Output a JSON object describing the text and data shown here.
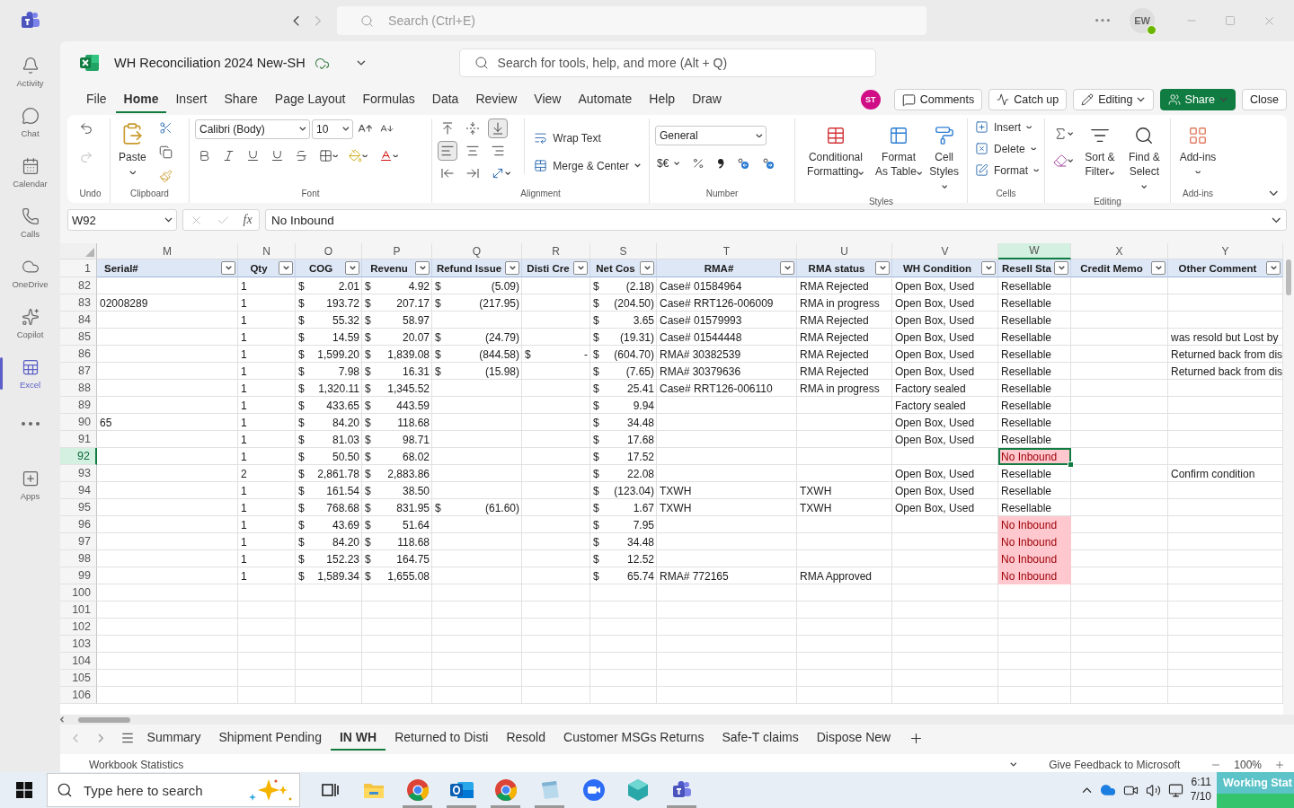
{
  "teams_bar": {
    "search": {
      "placeholder": "Search (Ctrl+E)"
    },
    "avatar": "EW"
  },
  "rail": [
    {
      "label": "Activity",
      "kind": "bell",
      "selected": false
    },
    {
      "label": "Chat",
      "kind": "chat",
      "selected": false
    },
    {
      "label": "Calendar",
      "kind": "calendar",
      "selected": false
    },
    {
      "label": "Calls",
      "kind": "calls",
      "selected": false
    },
    {
      "label": "OneDrive",
      "kind": "cloud",
      "selected": false
    },
    {
      "label": "Copilot",
      "kind": "copilot",
      "selected": false
    },
    {
      "label": "Excel",
      "kind": "excel",
      "selected": true
    },
    {
      "kind": "more",
      "selected": false
    },
    {
      "label": "Apps",
      "kind": "apps",
      "selected": false
    }
  ],
  "workbook": {
    "title": "WH Reconciliation 2024 New-SH",
    "search": {
      "placeholder": "Search for tools, help, and more (Alt + Q)"
    }
  },
  "menu": [
    {
      "label": "File",
      "selected": false
    },
    {
      "label": "Home",
      "selected": true
    },
    {
      "label": "Insert",
      "selected": false
    },
    {
      "label": "Share",
      "selected": false
    },
    {
      "label": "Page Layout",
      "selected": false
    },
    {
      "label": "Formulas",
      "selected": false
    },
    {
      "label": "Data",
      "selected": false
    },
    {
      "label": "Review",
      "selected": false
    },
    {
      "label": "View",
      "selected": false
    },
    {
      "label": "Automate",
      "selected": false
    },
    {
      "label": "Help",
      "selected": false
    },
    {
      "label": "Draw",
      "selected": false
    }
  ],
  "actions": {
    "presence": "ST",
    "buttons": [
      {
        "label": "Comments",
        "kind": "comments"
      },
      {
        "label": "Catch up",
        "kind": "catchup"
      },
      {
        "label": "Editing",
        "kind": "editing"
      },
      {
        "label": "Share",
        "kind": "share"
      },
      {
        "label": "Close",
        "kind": "close"
      }
    ]
  },
  "ribbon": {
    "undo": {
      "label": "Undo"
    },
    "clipboard": {
      "paste": "Paste",
      "label": "Clipboard"
    },
    "font": {
      "name": "Calibri (Body)",
      "size": "10",
      "label": "Font"
    },
    "alignment": {
      "wrap": "Wrap Text",
      "merge": "Merge & Center",
      "label": "Alignment"
    },
    "number": {
      "format": "General",
      "currency": "$€",
      "label": "Number"
    },
    "styles": {
      "buttons": [
        "Conditional Formatting",
        "Format As Table",
        "Cell Styles"
      ],
      "label": "Styles"
    },
    "cells": {
      "buttons": [
        "Insert",
        "Delete",
        "Format"
      ],
      "label": "Cells"
    },
    "editing": {
      "buttons": [
        "Sort & Filter",
        "Find & Select"
      ],
      "label": "Editing"
    },
    "addins": {
      "button": "Add-ins",
      "label": "Add-ins"
    }
  },
  "formula_bar": {
    "name_box": "W92",
    "function_label": "fx",
    "value": "No Inbound"
  },
  "sheet": {
    "header_row": "1",
    "columns": [
      {
        "letter": "M",
        "header": "Serial#",
        "selected": false
      },
      {
        "letter": "N",
        "header": "Qty",
        "selected": false
      },
      {
        "letter": "O",
        "header": "COG",
        "selected": false
      },
      {
        "letter": "P",
        "header": "Revenu",
        "selected": false
      },
      {
        "letter": "Q",
        "header": "Refund Issue",
        "selected": false
      },
      {
        "letter": "R",
        "header": "Disti Cre",
        "selected": false
      },
      {
        "letter": "S",
        "header": "Net Cos",
        "selected": false
      },
      {
        "letter": "T",
        "header": "RMA#",
        "selected": false
      },
      {
        "letter": "U",
        "header": "RMA status",
        "selected": false
      },
      {
        "letter": "V",
        "header": "WH Condition",
        "selected": false
      },
      {
        "letter": "W",
        "header": "Resell Sta",
        "selected": true
      },
      {
        "letter": "X",
        "header": "Credit Memo",
        "selected": false
      },
      {
        "letter": "Y",
        "header": "Other Comment",
        "selected": false
      }
    ],
    "rows": [
      {
        "number": "82",
        "selected": false,
        "flagged": false,
        "cells": [
          null,
          "1",
          [
            "$",
            "2.01"
          ],
          [
            "$",
            "4.92"
          ],
          [
            "$",
            "(5.09)"
          ],
          null,
          [
            "$",
            "(2.18)"
          ],
          "Case# 01584964",
          "RMA Rejected",
          "Open Box, Used",
          "Resellable",
          null,
          null
        ]
      },
      {
        "number": "83",
        "selected": false,
        "flagged": false,
        "cells": [
          "02008289",
          "1",
          [
            "$",
            "193.72"
          ],
          [
            "$",
            "207.17"
          ],
          [
            "$",
            "(217.95)"
          ],
          null,
          [
            "$",
            "(204.50)"
          ],
          "Case# RRT126-006009",
          "RMA in progress",
          "Open Box, Used",
          "Resellable",
          null,
          null
        ]
      },
      {
        "number": "84",
        "selected": false,
        "flagged": false,
        "cells": [
          null,
          "1",
          [
            "$",
            "55.32"
          ],
          [
            "$",
            "58.97"
          ],
          null,
          null,
          [
            "$",
            "3.65"
          ],
          "Case# 01579993",
          "RMA Rejected",
          "Open Box, Used",
          "Resellable",
          null,
          null
        ]
      },
      {
        "number": "85",
        "selected": false,
        "flagged": false,
        "cells": [
          null,
          "1",
          [
            "$",
            "14.59"
          ],
          [
            "$",
            "20.07"
          ],
          [
            "$",
            "(24.79)"
          ],
          null,
          [
            "$",
            "(19.31)"
          ],
          "Case# 01544448",
          "RMA Rejected",
          "Open Box, Used",
          "Resellable",
          null,
          "was resold but Lost by"
        ]
      },
      {
        "number": "86",
        "selected": false,
        "flagged": false,
        "cells": [
          null,
          "1",
          [
            "$",
            "1,599.20"
          ],
          [
            "$",
            "1,839.08"
          ],
          [
            "$",
            "(844.58)"
          ],
          [
            "$",
            "-"
          ],
          [
            "$",
            "(604.70)"
          ],
          "RMA# 30382539",
          "RMA Rejected",
          "Open Box, Used",
          "Resellable",
          null,
          "Returned back from dis"
        ]
      },
      {
        "number": "87",
        "selected": false,
        "flagged": false,
        "cells": [
          null,
          "1",
          [
            "$",
            "7.98"
          ],
          [
            "$",
            "16.31"
          ],
          [
            "$",
            "(15.98)"
          ],
          null,
          [
            "$",
            "(7.65)"
          ],
          "RMA# 30379636",
          "RMA Rejected",
          "Open Box, Used",
          "Resellable",
          null,
          "Returned back from dis"
        ]
      },
      {
        "number": "88",
        "selected": false,
        "flagged": false,
        "cells": [
          null,
          "1",
          [
            "$",
            "1,320.11"
          ],
          [
            "$",
            "1,345.52"
          ],
          null,
          null,
          [
            "$",
            "25.41"
          ],
          "Case# RRT126-006110",
          "RMA in progress",
          "Factory sealed",
          "Resellable",
          null,
          null
        ]
      },
      {
        "number": "89",
        "selected": false,
        "flagged": false,
        "cells": [
          null,
          "1",
          [
            "$",
            "433.65"
          ],
          [
            "$",
            "443.59"
          ],
          null,
          null,
          [
            "$",
            "9.94"
          ],
          null,
          null,
          "Factory sealed",
          "Resellable",
          null,
          null
        ]
      },
      {
        "number": "90",
        "selected": false,
        "flagged": false,
        "cells": [
          "65",
          "1",
          [
            "$",
            "84.20"
          ],
          [
            "$",
            "118.68"
          ],
          null,
          null,
          [
            "$",
            "34.48"
          ],
          null,
          null,
          "Open Box, Used",
          "Resellable",
          null,
          null
        ]
      },
      {
        "number": "91",
        "selected": false,
        "flagged": false,
        "cells": [
          null,
          "1",
          [
            "$",
            "81.03"
          ],
          [
            "$",
            "98.71"
          ],
          null,
          null,
          [
            "$",
            "17.68"
          ],
          null,
          null,
          "Open Box, Used",
          "Resellable",
          null,
          null
        ]
      },
      {
        "number": "92",
        "selected": true,
        "flagged": true,
        "cells": [
          null,
          "1",
          [
            "$",
            "50.50"
          ],
          [
            "$",
            "68.02"
          ],
          null,
          null,
          [
            "$",
            "17.52"
          ],
          null,
          null,
          null,
          "No Inbound",
          null,
          null
        ]
      },
      {
        "number": "93",
        "selected": false,
        "flagged": false,
        "cells": [
          null,
          "2",
          [
            "$",
            "2,861.78"
          ],
          [
            "$",
            "2,883.86"
          ],
          null,
          null,
          [
            "$",
            "22.08"
          ],
          null,
          null,
          "Open Box, Used",
          "Resellable",
          null,
          "Confirm condition"
        ]
      },
      {
        "number": "94",
        "selected": false,
        "flagged": false,
        "cells": [
          null,
          "1",
          [
            "$",
            "161.54"
          ],
          [
            "$",
            "38.50"
          ],
          null,
          null,
          [
            "$",
            "(123.04)"
          ],
          "TXWH",
          "TXWH",
          "Open Box, Used",
          "Resellable",
          null,
          null
        ]
      },
      {
        "number": "95",
        "selected": false,
        "flagged": false,
        "cells": [
          null,
          "1",
          [
            "$",
            "768.68"
          ],
          [
            "$",
            "831.95"
          ],
          [
            "$",
            "(61.60)"
          ],
          null,
          [
            "$",
            "1.67"
          ],
          "TXWH",
          "TXWH",
          "Open Box, Used",
          "Resellable",
          null,
          null
        ]
      },
      {
        "number": "96",
        "selected": false,
        "flagged": true,
        "cells": [
          null,
          "1",
          [
            "$",
            "43.69"
          ],
          [
            "$",
            "51.64"
          ],
          null,
          null,
          [
            "$",
            "7.95"
          ],
          null,
          null,
          null,
          "No Inbound",
          null,
          null
        ]
      },
      {
        "number": "97",
        "selected": false,
        "flagged": true,
        "cells": [
          null,
          "1",
          [
            "$",
            "84.20"
          ],
          [
            "$",
            "118.68"
          ],
          null,
          null,
          [
            "$",
            "34.48"
          ],
          null,
          null,
          null,
          "No Inbound",
          null,
          null
        ]
      },
      {
        "number": "98",
        "selected": false,
        "flagged": true,
        "cells": [
          null,
          "1",
          [
            "$",
            "152.23"
          ],
          [
            "$",
            "164.75"
          ],
          null,
          null,
          [
            "$",
            "12.52"
          ],
          null,
          null,
          null,
          "No Inbound",
          null,
          null
        ]
      },
      {
        "number": "99",
        "selected": false,
        "flagged": true,
        "cells": [
          null,
          "1",
          [
            "$",
            "1,589.34"
          ],
          [
            "$",
            "1,655.08"
          ],
          null,
          null,
          [
            "$",
            "65.74"
          ],
          "RMA# 772165",
          "RMA Approved",
          null,
          "No Inbound",
          null,
          null
        ]
      },
      {
        "number": "100",
        "selected": false,
        "flagged": false
      },
      {
        "number": "101",
        "selected": false,
        "flagged": false
      },
      {
        "number": "102",
        "selected": false,
        "flagged": false
      },
      {
        "number": "103",
        "selected": false,
        "flagged": false
      },
      {
        "number": "104",
        "selected": false,
        "flagged": false
      },
      {
        "number": "105",
        "selected": false,
        "flagged": false
      },
      {
        "number": "106",
        "selected": false,
        "flagged": false
      }
    ]
  },
  "sheet_tabs": [
    {
      "label": "Summary",
      "selected": false
    },
    {
      "label": "Shipment Pending",
      "selected": false
    },
    {
      "label": "IN WH",
      "selected": true
    },
    {
      "label": "Returned to Disti",
      "selected": false
    },
    {
      "label": "Resold",
      "selected": false
    },
    {
      "label": "Customer MSGs Returns",
      "selected": false
    },
    {
      "label": "Safe-T claims",
      "selected": false
    },
    {
      "label": "Dispose New",
      "selected": false
    }
  ],
  "status_bar": {
    "left": "Workbook Statistics",
    "feedback": "Give Feedback to Microsoft",
    "zoom": "100%"
  },
  "taskbar": {
    "search": {
      "placeholder": "Type here to search"
    },
    "apps": [
      {
        "kind": "taskview",
        "running": false
      },
      {
        "kind": "explorer",
        "running": false
      },
      {
        "kind": "chrome",
        "running": true
      },
      {
        "kind": "outlook",
        "running": true
      },
      {
        "kind": "chrome",
        "running": true
      },
      {
        "kind": "notepad",
        "running": true
      },
      {
        "kind": "zoom",
        "running": false
      },
      {
        "kind": "diamond",
        "running": false
      },
      {
        "kind": "teams",
        "running": true
      }
    ],
    "clock": {
      "time": "6:11",
      "date": "7/10"
    }
  },
  "widget": {
    "label": "Working Stat"
  }
}
